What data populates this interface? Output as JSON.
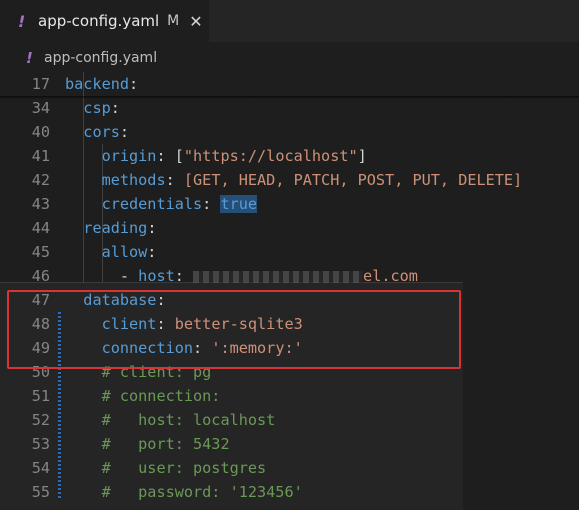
{
  "tab": {
    "icon": "yaml-file-icon",
    "title": "app-config.yaml",
    "status": "M",
    "close": "✕"
  },
  "breadcrumb": {
    "icon": "yaml-file-icon",
    "text": "app-config.yaml"
  },
  "colors": {
    "highlight": "#d73535",
    "key": "#569cd6",
    "string": "#ce9178",
    "comment": "#6a9955",
    "line_number": "#858585"
  },
  "lines": [
    {
      "n": "17",
      "indent": "",
      "tokens": [
        [
          "key",
          "backend"
        ],
        [
          "punc",
          ":"
        ]
      ]
    },
    {
      "n": "34",
      "indent": "  ",
      "tokens": [
        [
          "key",
          "csp"
        ],
        [
          "punc",
          ":"
        ]
      ]
    },
    {
      "n": "40",
      "indent": "  ",
      "tokens": [
        [
          "key",
          "cors"
        ],
        [
          "punc",
          ":"
        ]
      ]
    },
    {
      "n": "41",
      "indent": "    ",
      "tokens": [
        [
          "key",
          "origin"
        ],
        [
          "punc",
          ": ["
        ],
        [
          "str",
          "\"https://localhost\""
        ],
        [
          "punc",
          "]"
        ]
      ]
    },
    {
      "n": "42",
      "indent": "    ",
      "tokens": [
        [
          "key",
          "methods"
        ],
        [
          "punc",
          ": "
        ],
        [
          "str",
          "[GET, HEAD, PATCH, POST, PUT, DELETE]"
        ]
      ]
    },
    {
      "n": "43",
      "indent": "    ",
      "tokens": [
        [
          "key",
          "credentials"
        ],
        [
          "punc",
          ": "
        ],
        [
          "bool",
          "true"
        ]
      ]
    },
    {
      "n": "44",
      "indent": "  ",
      "tokens": [
        [
          "key",
          "reading"
        ],
        [
          "punc",
          ":"
        ]
      ]
    },
    {
      "n": "45",
      "indent": "    ",
      "tokens": [
        [
          "key",
          "allow"
        ],
        [
          "punc",
          ":"
        ]
      ]
    },
    {
      "n": "46",
      "indent": "      ",
      "tokens": [
        [
          "punc",
          "- "
        ],
        [
          "key",
          "host"
        ],
        [
          "punc",
          ": "
        ],
        [
          "blur",
          ""
        ],
        [
          "str",
          "el.com"
        ]
      ]
    },
    {
      "n": "47",
      "indent": "  ",
      "tokens": [
        [
          "key",
          "database"
        ],
        [
          "punc",
          ":"
        ]
      ]
    },
    {
      "n": "48",
      "indent": "    ",
      "tokens": [
        [
          "key",
          "client"
        ],
        [
          "punc",
          ": "
        ],
        [
          "str",
          "better-sqlite3"
        ]
      ]
    },
    {
      "n": "49",
      "indent": "    ",
      "tokens": [
        [
          "key",
          "connection"
        ],
        [
          "punc",
          ": "
        ],
        [
          "str",
          "':memory:'"
        ]
      ]
    },
    {
      "n": "50",
      "indent": "    ",
      "tokens": [
        [
          "comment",
          "# client: pg"
        ]
      ]
    },
    {
      "n": "51",
      "indent": "    ",
      "tokens": [
        [
          "comment",
          "# connection:"
        ]
      ]
    },
    {
      "n": "52",
      "indent": "    ",
      "tokens": [
        [
          "comment",
          "#   host: localhost"
        ]
      ]
    },
    {
      "n": "53",
      "indent": "    ",
      "tokens": [
        [
          "comment",
          "#   port: 5432"
        ]
      ]
    },
    {
      "n": "54",
      "indent": "    ",
      "tokens": [
        [
          "comment",
          "#   user: postgres"
        ]
      ]
    },
    {
      "n": "55",
      "indent": "    ",
      "tokens": [
        [
          "comment",
          "#   password: '123456'"
        ]
      ]
    }
  ]
}
